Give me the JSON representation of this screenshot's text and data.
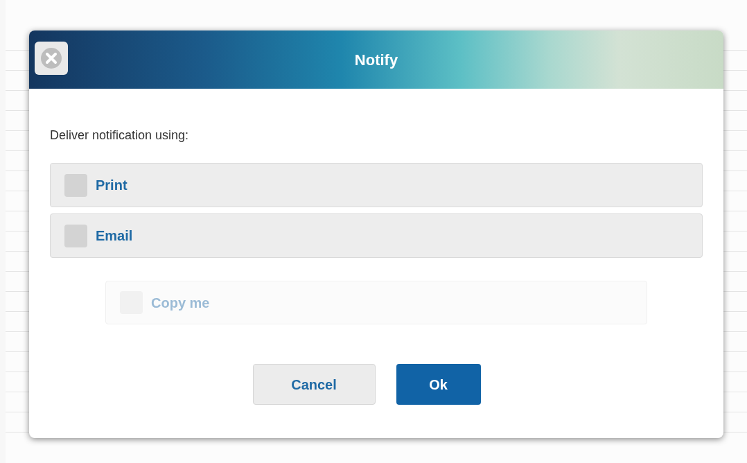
{
  "dialog": {
    "title": "Notify",
    "prompt": "Deliver notification using:",
    "options": [
      {
        "label": "Print",
        "checked": false,
        "disabled": false
      },
      {
        "label": "Email",
        "checked": false,
        "disabled": false
      }
    ],
    "copy_option": {
      "label": "Copy me",
      "checked": false,
      "disabled": true
    },
    "buttons": [
      {
        "label": "Cancel",
        "kind": "secondary"
      },
      {
        "label": "Ok",
        "kind": "primary"
      }
    ]
  }
}
